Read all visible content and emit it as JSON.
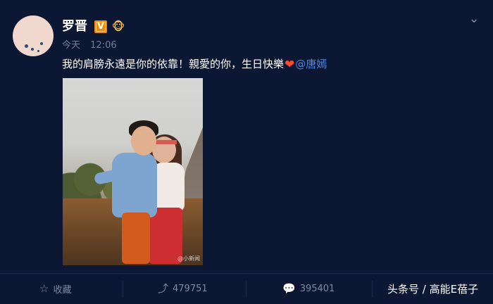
{
  "profile": {
    "name": "罗晋",
    "verified_badge": "V",
    "member_badge": "🐵"
  },
  "meta": {
    "day": "今天",
    "time": "12:06"
  },
  "post": {
    "text_prefix": "我的肩膀永遠是你的依靠！親愛的你，生日快樂",
    "heart_icon": "❤",
    "mention": "@唐嫣"
  },
  "photo": {
    "watermark": "@小新闻"
  },
  "actions": {
    "favorite": "收藏",
    "reposts": "479751",
    "comments": "395401"
  },
  "source_label": "头条号 / 高能E蓓子"
}
